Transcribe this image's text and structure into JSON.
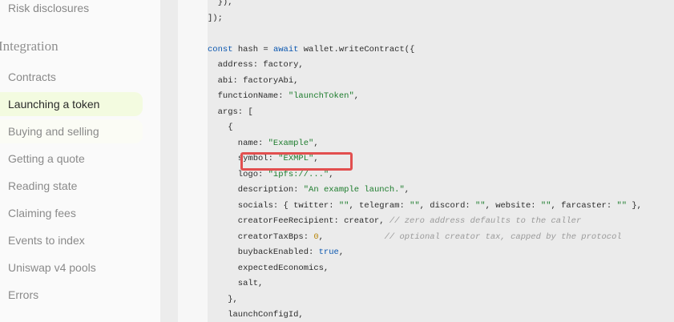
{
  "sidebar": {
    "top_item": "Risk disclosures",
    "section_title": "Integration",
    "items": [
      {
        "label": "Contracts"
      },
      {
        "label": "Launching a token"
      },
      {
        "label": "Buying and selling"
      },
      {
        "label": "Getting a quote"
      },
      {
        "label": "Reading state"
      },
      {
        "label": "Claiming fees"
      },
      {
        "label": "Events to index"
      },
      {
        "label": "Uniswap v4 pools"
      },
      {
        "label": "Errors"
      }
    ]
  },
  "code": {
    "l1": "  }),",
    "l2": "]);",
    "l4_kw": "const",
    "l4_a": " hash = ",
    "l4_kw2": "await",
    "l4_b": " wallet.writeContract({",
    "l5": "  address: factory,",
    "l6": "  abi: factoryAbi,",
    "l7_a": "  functionName: ",
    "l7_s": "\"launchToken\"",
    "l7_b": ",",
    "l8": "  args: [",
    "l9": "    {",
    "l10_a": "      name: ",
    "l10_s": "\"Example\"",
    "l10_b": ",",
    "l11_a": "      symbol: ",
    "l11_s": "\"EXMPL\"",
    "l11_b": ",",
    "l12_a": "      logo: ",
    "l12_s": "\"ipfs://...\"",
    "l12_b": ",",
    "l13_a": "      description: ",
    "l13_s": "\"An example launch.\"",
    "l13_b": ",",
    "l14_a": "      socials: { twitter: ",
    "l14_s1": "\"\"",
    "l14_b": ", telegram: ",
    "l14_s2": "\"\"",
    "l14_c": ", discord: ",
    "l14_s3": "\"\"",
    "l14_d": ", website: ",
    "l14_s4": "\"\"",
    "l14_e": ", farcaster: ",
    "l14_s5": "\"\"",
    "l14_f": " },",
    "l15_a": "      creatorFeeRecipient: creator, ",
    "l15_c": "// zero address defaults to the caller",
    "l16_a": "      creatorTaxBps: ",
    "l16_n": "0",
    "l16_b": ",            ",
    "l16_c": "// optional creator tax, capped by the protocol",
    "l17_a": "      buybackEnabled: ",
    "l17_v": "true",
    "l17_b": ",",
    "l18": "      expectedEconomics,",
    "l19": "      salt,",
    "l20": "    },",
    "l21": "    launchConfigId,"
  }
}
